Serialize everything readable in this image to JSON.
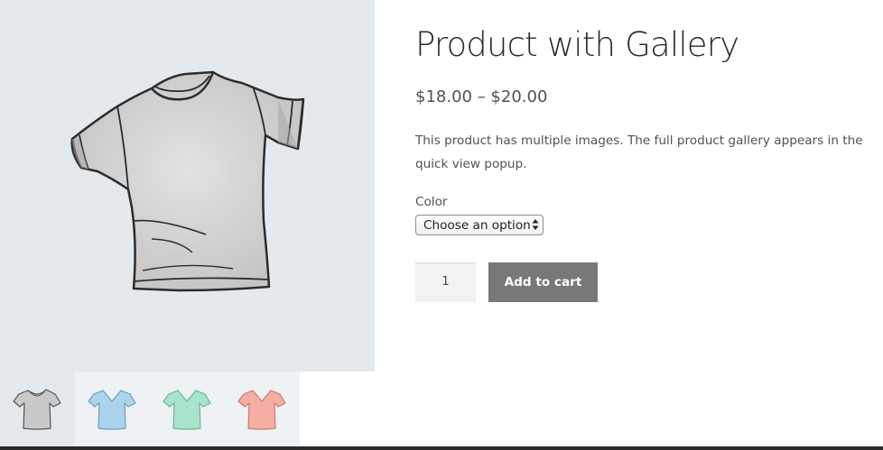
{
  "product": {
    "title": "Product with Gallery",
    "price": "$18.00 – $20.00",
    "description": "This product has multiple images. The full product gallery appears in the quick view popup."
  },
  "variations": {
    "label": "Color",
    "selected": "Choose an option"
  },
  "cart": {
    "quantity": "1",
    "add_to_cart_label": "Add to cart"
  },
  "gallery": {
    "main_icon": "tshirt-gray",
    "thumbnails": [
      {
        "icon": "tshirt-gray-icon",
        "color": "#cfcfcf"
      },
      {
        "icon": "vneck-blue-icon",
        "color": "#a9d4ec"
      },
      {
        "icon": "vneck-mint-icon",
        "color": "#a8e3cc"
      },
      {
        "icon": "vneck-pink-icon",
        "color": "#f4aea2"
      }
    ]
  },
  "colors": {
    "gallery_background": "#e4e9ee",
    "button_background": "#787878",
    "text": "#515151",
    "title": "#2b2b2b"
  }
}
